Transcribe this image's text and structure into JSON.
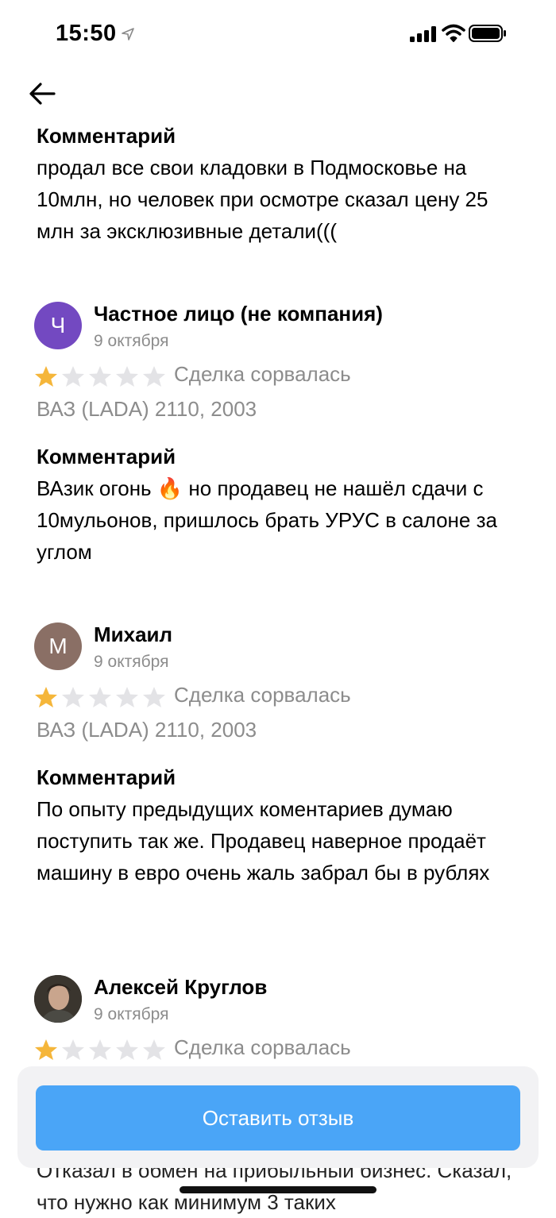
{
  "status_bar": {
    "time": "15:50"
  },
  "first_comment": {
    "title": "Комментарий",
    "text": "продал все свои кладовки в Подмосковье на 10млн, но человек при осмотре сказал цену 25 млн за эксклюзивные детали((("
  },
  "reviews": [
    {
      "avatar_letter": "Ч",
      "avatar_color": "#7349c1",
      "author": "Частное лицо (не компания)",
      "date": "9 октября",
      "rating": 1,
      "max_rating": 5,
      "status": "Сделка сорвалась",
      "car": "ВАЗ (LADA) 2110, 2003",
      "comment_title": "Комментарий",
      "comment": "ВАзик огонь 🔥 но продавец не нашёл сдачи с 10мульонов, пришлось брать УРУС в салоне за углом"
    },
    {
      "avatar_letter": "М",
      "avatar_color": "#8a6f65",
      "author": "Михаил",
      "date": "9 октября",
      "rating": 1,
      "max_rating": 5,
      "status": "Сделка сорвалась",
      "car": "ВАЗ (LADA) 2110, 2003",
      "comment_title": "Комментарий",
      "comment": "По опыту предыдущих коментариев думаю поступить так же. Продавец наверное продаёт машину в евро очень жаль забрал бы в рублях"
    },
    {
      "avatar_letter": "",
      "avatar_color": "#3a352e",
      "author": "Алексей Круглов",
      "date": "9 октября",
      "rating": 1,
      "max_rating": 5,
      "status": "Сделка сорвалась"
    }
  ],
  "leave_review_label": "Оставить отзыв",
  "partial_text": "Отказал в обмен на прибыльный бизнес. Сказал, что нужно как минимум 3 таких",
  "colors": {
    "star_filled": "#f5b63a",
    "star_empty": "#e3e3e6",
    "button": "#4aa5f7"
  }
}
